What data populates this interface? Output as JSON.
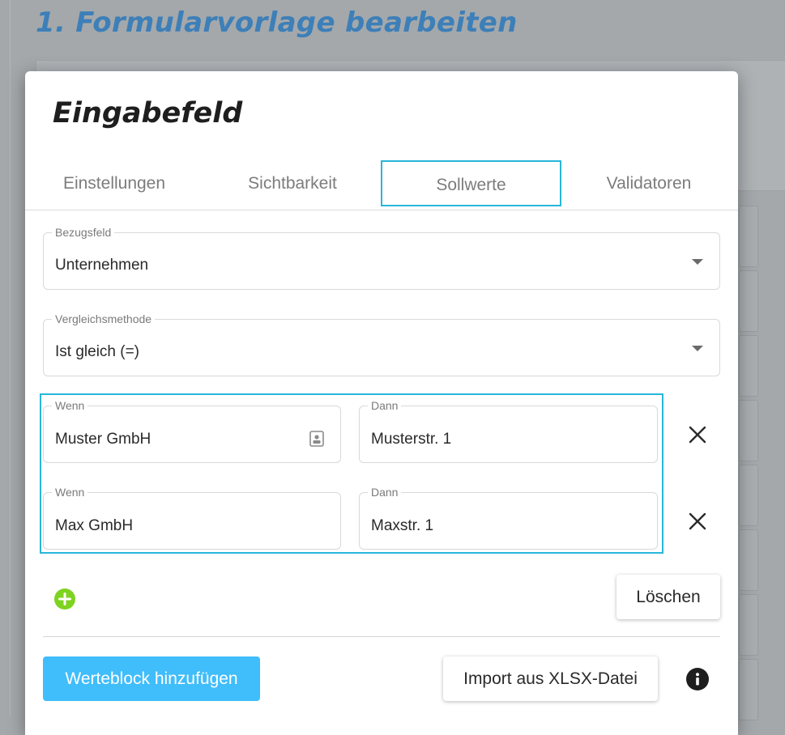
{
  "background": {
    "page_title": "1. Formularvorlage bearbeiten"
  },
  "dialog": {
    "title": "Eingabefeld",
    "tabs": [
      {
        "label": "Einstellungen",
        "active": false
      },
      {
        "label": "Sichtbarkeit",
        "active": false
      },
      {
        "label": "Sollwerte",
        "active": true
      },
      {
        "label": "Validatoren",
        "active": false
      }
    ],
    "reference_field": {
      "label": "Bezugsfeld",
      "value": "Unternehmen"
    },
    "comparison_method": {
      "label": "Vergleichsmethode",
      "value": "Ist gleich (=)"
    },
    "pairs": [
      {
        "if_label": "Wenn",
        "if_value": "Muster GmbH",
        "then_label": "Dann",
        "then_value": "Musterstr. 1"
      },
      {
        "if_label": "Wenn",
        "if_value": "Max GmbH",
        "then_label": "Dann",
        "then_value": "Maxstr. 1"
      }
    ],
    "delete_label": "Löschen",
    "add_block_label": "Werteblock hinzufügen",
    "import_label": "Import aus XLSX-Datei"
  },
  "icons": {
    "dropdown": "chevron-down-icon",
    "contact": "contact-card-icon",
    "remove": "close-icon",
    "add": "plus-icon",
    "info": "info-icon"
  },
  "colors": {
    "accent_border": "#29b6d9",
    "primary_button": "#40bdfb",
    "add_button": "#7ed321",
    "page_title": "#3d7fb8"
  }
}
